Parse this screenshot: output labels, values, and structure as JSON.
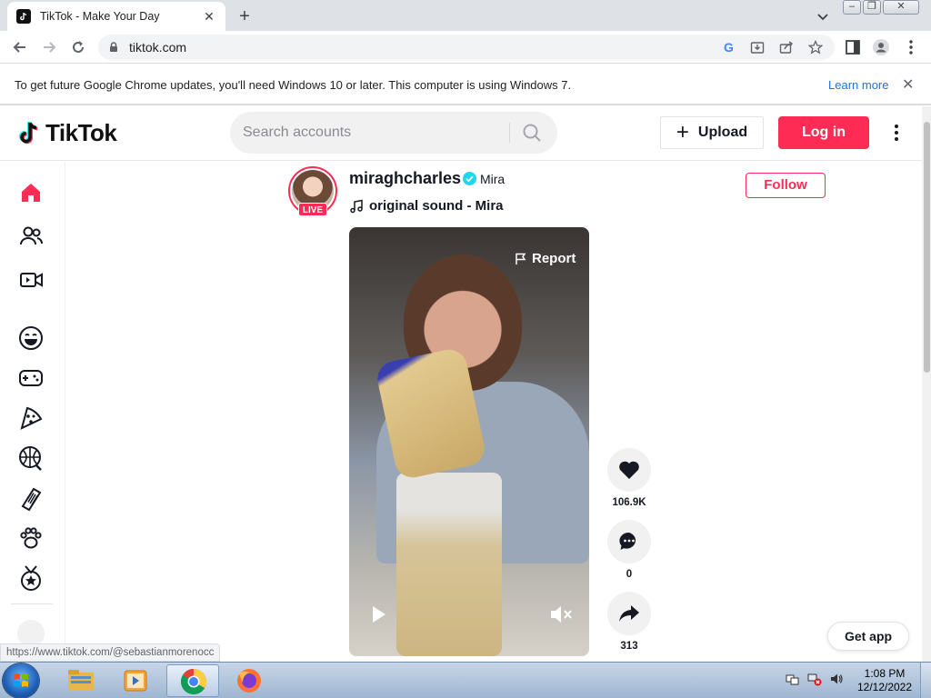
{
  "browser": {
    "tab_title": "TikTok - Make Your Day",
    "tab_close": "✕",
    "new_tab": "+",
    "url": "tiktok.com",
    "infobar_message": "To get future Google Chrome updates, you'll need Windows 10 or later. This computer is using Windows 7.",
    "infobar_link": "Learn more",
    "infobar_close": "✕",
    "status_url": "https://www.tiktok.com/@sebastianmorenocc"
  },
  "tiktok": {
    "logo_text": "TikTok",
    "search_placeholder": "Search accounts",
    "upload_label": "Upload",
    "upload_plus": "+",
    "login_label": "Log in",
    "sidebar": [
      "home-icon",
      "following-icon",
      "live-icon",
      "comedy-icon",
      "gaming-icon",
      "food-icon",
      "sports-icon",
      "beauty-icon",
      "animals-icon",
      "achievement-icon"
    ],
    "post": {
      "username": "miraghcharles",
      "nickname": "Mira",
      "live_badge": "LIVE",
      "sound": "original sound - Mira",
      "follow_label": "Follow",
      "report_label": "Report",
      "likes": "106.9K",
      "comments": "0",
      "shares": "313"
    },
    "get_app_label": "Get app"
  },
  "taskbar": {
    "time": "1:08 PM",
    "date": "12/12/2022",
    "apps": [
      "explorer-icon",
      "media-player-icon",
      "chrome-icon",
      "firefox-icon"
    ]
  },
  "colors": {
    "tiktok_red": "#fe2c55",
    "verified_blue": "#20d5ec",
    "link_blue": "#1a73e8"
  }
}
